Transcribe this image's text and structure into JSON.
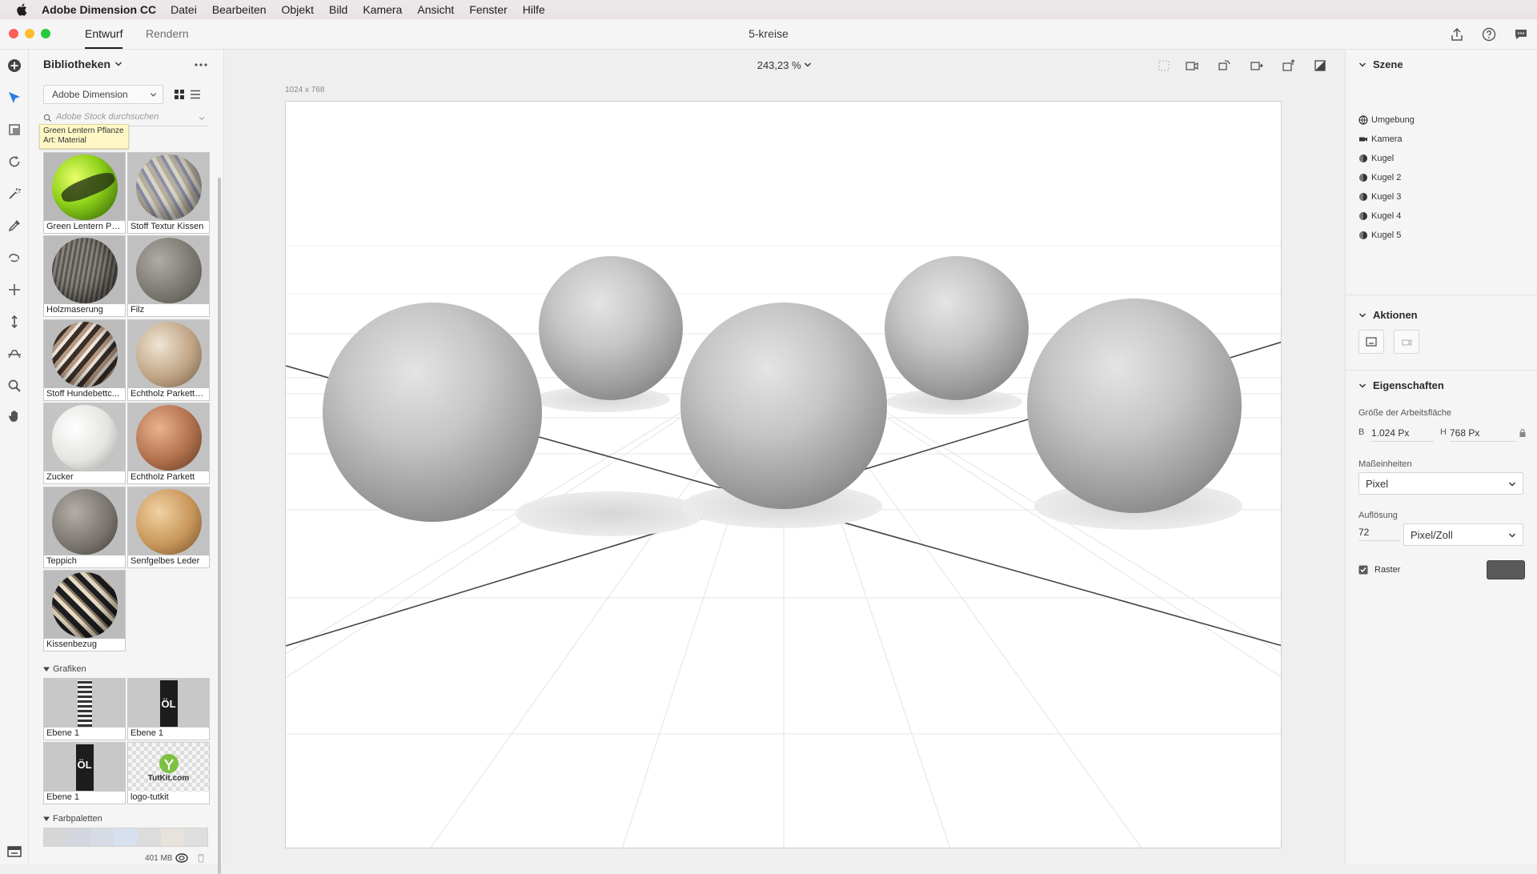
{
  "menubar": {
    "app_name": "Adobe Dimension CC",
    "items": [
      "Datei",
      "Bearbeiten",
      "Objekt",
      "Bild",
      "Kamera",
      "Ansicht",
      "Fenster",
      "Hilfe"
    ]
  },
  "titlebar": {
    "tabs": [
      {
        "label": "Entwurf",
        "active": true
      },
      {
        "label": "Rendern",
        "active": false
      }
    ],
    "document_title": "5-kreise"
  },
  "libraries": {
    "title": "Bibliotheken",
    "source": "Adobe Dimension",
    "search_placeholder": "Adobe Stock durchsuchen",
    "tooltip": {
      "line1": "Green Lentern Pflanze",
      "line2": "Art: Material"
    },
    "materials": [
      {
        "label": "Green Lentern Pfl..."
      },
      {
        "label": "Stoff Textur Kissen"
      },
      {
        "label": "Holzmaserung"
      },
      {
        "label": "Filz"
      },
      {
        "label": "Stoff Hundebettc..."
      },
      {
        "label": "Echtholz Parkettb..."
      },
      {
        "label": "Zucker"
      },
      {
        "label": "Echtholz Parkett"
      },
      {
        "label": "Teppich"
      },
      {
        "label": "Senfgelbes Leder"
      },
      {
        "label": "Kissenbezug"
      }
    ],
    "graphics_title": "Grafiken",
    "graphics": [
      {
        "label": "Ebene 1"
      },
      {
        "label": "Ebene 1"
      },
      {
        "label": "Ebene 1"
      },
      {
        "label": "logo-tutkit"
      }
    ],
    "graphic_texts": {
      "oel": "ÖL",
      "tutkit": "TutKit.com"
    },
    "palettes_title": "Farbpaletten",
    "palette_colors": [
      "#d6d6d6",
      "#d3d6df",
      "#d7dbe6",
      "#d6e0ef",
      "#dcdcdc",
      "#e8e2dc",
      "#dedede"
    ],
    "storage": "401 MB"
  },
  "canvas": {
    "zoom": "243,23 %",
    "size_label": "1024 x 768"
  },
  "scene": {
    "title": "Szene",
    "items": [
      {
        "label": "Umgebung",
        "icon": "environment-icon"
      },
      {
        "label": "Kamera",
        "icon": "camera-icon"
      },
      {
        "label": "Kugel",
        "icon": "sphere-icon"
      },
      {
        "label": "Kugel 2",
        "icon": "sphere-icon"
      },
      {
        "label": "Kugel 3",
        "icon": "sphere-icon"
      },
      {
        "label": "Kugel 4",
        "icon": "sphere-icon"
      },
      {
        "label": "Kugel 5",
        "icon": "sphere-icon"
      }
    ]
  },
  "actions": {
    "title": "Aktionen"
  },
  "properties": {
    "title": "Eigenschaften",
    "artboard_size_label": "Größe der Arbeitsfläche",
    "width_prefix": "B",
    "width_value": "1.024 Px",
    "height_prefix": "H",
    "height_value": "768 Px",
    "units_label": "Maßeinheiten",
    "units_value": "Pixel",
    "resolution_label": "Auflösung",
    "resolution_value": "72",
    "resolution_unit": "Pixel/Zoll",
    "grid_label": "Raster",
    "grid_checked": true,
    "grid_color": "#5a5a5a"
  }
}
